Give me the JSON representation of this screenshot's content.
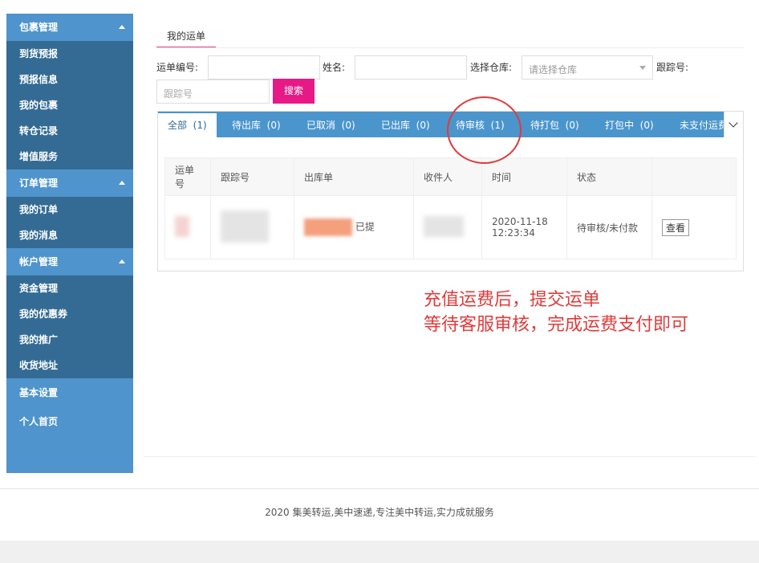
{
  "sidebar": {
    "groups": [
      {
        "label": "包裹管理",
        "items": [
          "到货预报",
          "预报信息",
          "我的包裹",
          "转仓记录",
          "增值服务"
        ]
      },
      {
        "label": "订单管理",
        "items": [
          "我的订单",
          "我的消息"
        ]
      },
      {
        "label": "帐户管理",
        "items": [
          "资金管理",
          "我的优惠券",
          "我的推广",
          "收货地址"
        ]
      }
    ],
    "plain": [
      "基本设置",
      "个人首页"
    ]
  },
  "top_tab": "我的运单",
  "filters": {
    "order_no_label": "运单编号:",
    "name_label": "姓名:",
    "warehouse_label": "选择仓库:",
    "warehouse_placeholder": "请选择仓库",
    "tracking_label": "跟踪号:",
    "tracking_placeholder": "跟踪号",
    "search_button": "搜索"
  },
  "status_tabs": [
    {
      "label": "全部",
      "count": "(1)"
    },
    {
      "label": "待出库",
      "count": "(0)"
    },
    {
      "label": "已取消",
      "count": "(0)"
    },
    {
      "label": "已出库",
      "count": "(0)"
    },
    {
      "label": "待审核",
      "count": "(1)"
    },
    {
      "label": "待打包",
      "count": "(0)"
    },
    {
      "label": "打包中",
      "count": "(0)"
    },
    {
      "label": "未支付运费",
      "count": ""
    }
  ],
  "table": {
    "headers": [
      "运单号",
      "跟踪号",
      "出库单",
      "收件人",
      "时间",
      "状态",
      ""
    ],
    "row": {
      "outbound_suffix": "已提",
      "time": "2020-11-18 12:23:34",
      "status": "待审核/未付款",
      "action": "查看"
    }
  },
  "annotation": {
    "line1": "充值运费后，提交运单",
    "line2": "等待客服审核，完成运费支付即可"
  },
  "footer": "2020 集美转运,美中速递,专注美中转运,实力成就服务",
  "colors": {
    "accent": "#e61987",
    "sidebar": "#2f6a9a",
    "sidebar_group": "#4f94cc",
    "annotation": "#e03b3b"
  }
}
